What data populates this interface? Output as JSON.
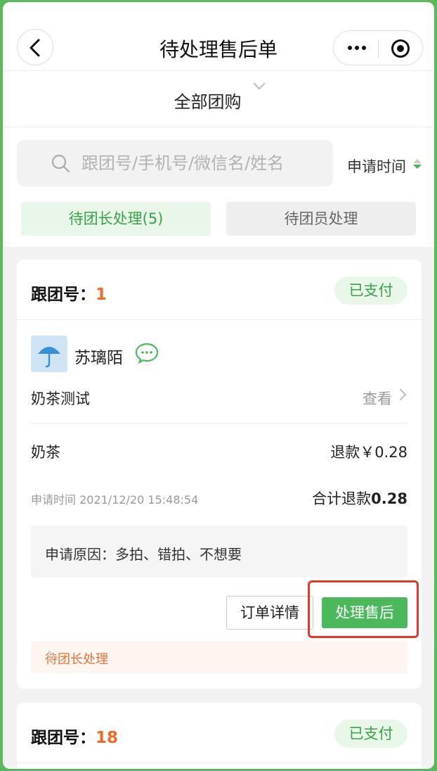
{
  "nav": {
    "title": "待处理售后单"
  },
  "group_filter": {
    "label": "全部团购"
  },
  "search": {
    "placeholder": "跟团号/手机号/微信名/姓名",
    "value": ""
  },
  "sort": {
    "label": "申请时间"
  },
  "tabs": [
    {
      "label": "待团长处理(5)",
      "active": true
    },
    {
      "label": "待团员处理",
      "active": false
    }
  ],
  "orders": [
    {
      "number_label": "跟团号：",
      "number": "1",
      "status": "已支付",
      "user_name": "苏璃陌",
      "product_group": "奶茶测试",
      "view_label": "查看",
      "item_name": "奶茶",
      "item_refund": "退款￥0.28",
      "apply_time": "申请时间 2021/12/20 15:48:54",
      "total_label": "合计退款",
      "total_value": "0.28",
      "reason": "申请原因：多拍、错拍、不想要",
      "detail_button": "订单详情",
      "handle_button": "处理售后",
      "pending_status": "待团长处理"
    },
    {
      "number_label": "跟团号：",
      "number": "18",
      "status": "已支付"
    }
  ],
  "colors": {
    "accent": "#4cb85c",
    "order_number": "#f06a2a",
    "highlight": "#e2372c"
  }
}
